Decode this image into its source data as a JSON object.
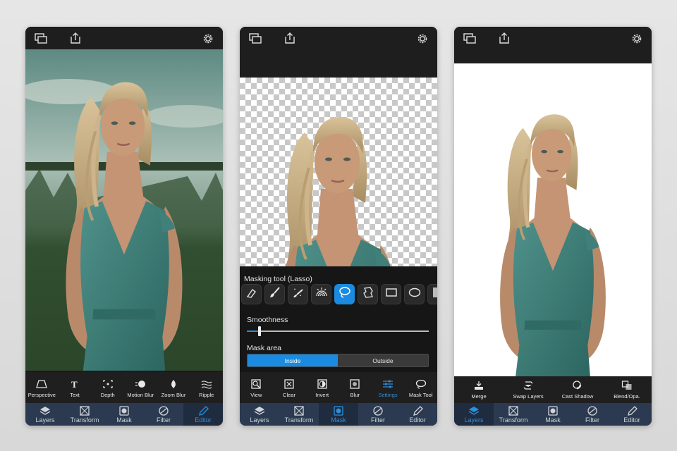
{
  "colors": {
    "accent": "#2c8fd9",
    "nav_bg": "#2b3a50",
    "dark": "#1b1b1b"
  },
  "phone1": {
    "tools": [
      {
        "label": "Perspective",
        "icon": "perspective-icon"
      },
      {
        "label": "Text",
        "icon": "text-icon"
      },
      {
        "label": "Depth",
        "icon": "depth-icon"
      },
      {
        "label": "Motion Blur",
        "icon": "motion-blur-icon"
      },
      {
        "label": "Zoom Blur",
        "icon": "zoom-blur-icon"
      },
      {
        "label": "Ripple",
        "icon": "ripple-icon"
      }
    ],
    "nav": [
      {
        "label": "Layers",
        "icon": "layers-icon"
      },
      {
        "label": "Transform",
        "icon": "transform-icon"
      },
      {
        "label": "Mask",
        "icon": "mask-icon"
      },
      {
        "label": "Filter",
        "icon": "filter-icon"
      },
      {
        "label": "Editor",
        "icon": "editor-icon",
        "active": true
      }
    ]
  },
  "phone2": {
    "panel_title": "Masking tool (Lasso)",
    "brushes": [
      "eraser-icon",
      "brush-icon",
      "magic-brush-icon",
      "rainbow-icon",
      "lasso-icon",
      "freeform-icon",
      "rectangle-icon",
      "ellipse-icon",
      "gradient-icon"
    ],
    "active_brush": "lasso-icon",
    "smoothness_label": "Smoothness",
    "smoothness_value": 0.07,
    "mask_area_label": "Mask area",
    "mask_area_options": [
      "Inside",
      "Outside"
    ],
    "mask_area_selected": "Inside",
    "tools": [
      {
        "label": "View",
        "icon": "view-icon"
      },
      {
        "label": "Clear",
        "icon": "clear-icon"
      },
      {
        "label": "Invert",
        "icon": "invert-icon"
      },
      {
        "label": "Blur",
        "icon": "blur-icon"
      },
      {
        "label": "Settings",
        "icon": "settings-sliders-icon",
        "active": true
      },
      {
        "label": "Mask Tool",
        "icon": "mask-tool-icon"
      }
    ],
    "nav": [
      {
        "label": "Layers",
        "icon": "layers-icon"
      },
      {
        "label": "Transform",
        "icon": "transform-icon"
      },
      {
        "label": "Mask",
        "icon": "mask-icon",
        "active": true
      },
      {
        "label": "Filter",
        "icon": "filter-icon"
      },
      {
        "label": "Editor",
        "icon": "editor-icon"
      }
    ]
  },
  "phone3": {
    "tools": [
      {
        "label": "Merge",
        "icon": "merge-icon"
      },
      {
        "label": "Swap Layers",
        "icon": "swap-layers-icon"
      },
      {
        "label": "Cast Shadow",
        "icon": "cast-shadow-icon"
      },
      {
        "label": "Blend/Opa.",
        "icon": "blend-opacity-icon"
      }
    ],
    "nav": [
      {
        "label": "Layers",
        "icon": "layers-icon",
        "active": true
      },
      {
        "label": "Transform",
        "icon": "transform-icon"
      },
      {
        "label": "Mask",
        "icon": "mask-icon"
      },
      {
        "label": "Filter",
        "icon": "filter-icon"
      },
      {
        "label": "Editor",
        "icon": "editor-icon"
      }
    ]
  }
}
